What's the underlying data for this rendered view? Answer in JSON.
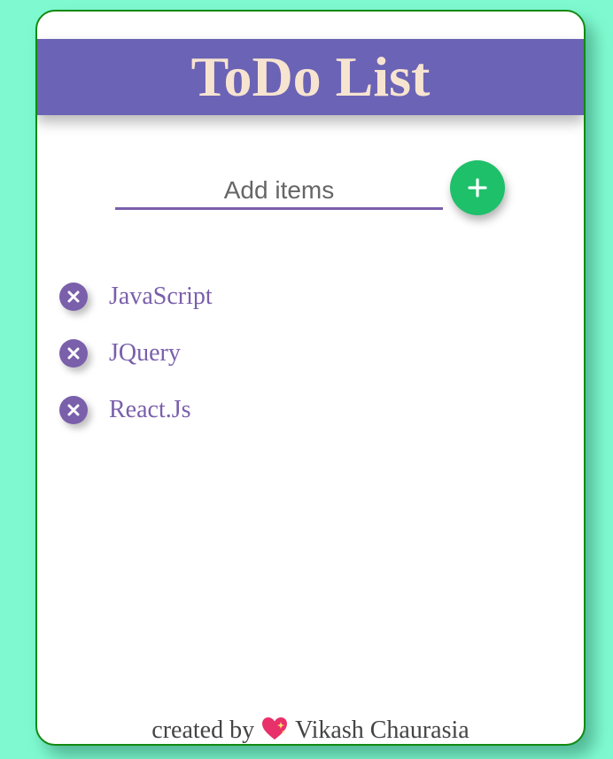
{
  "header": {
    "title": "ToDo List"
  },
  "add": {
    "placeholder": "Add items",
    "value": ""
  },
  "items": [
    {
      "label": "JavaScript"
    },
    {
      "label": "JQuery"
    },
    {
      "label": "React.Js"
    }
  ],
  "footer": {
    "prefix": "created by",
    "author": "Vikash Chaurasia",
    "heart_icon": "sparkling-heart-icon"
  },
  "colors": {
    "background": "#7ffad0",
    "header": "#6b63b5",
    "title": "#f7e4d0",
    "accent": "#7a5fab",
    "add_button": "#1ec06a",
    "card_border": "#118a11"
  }
}
